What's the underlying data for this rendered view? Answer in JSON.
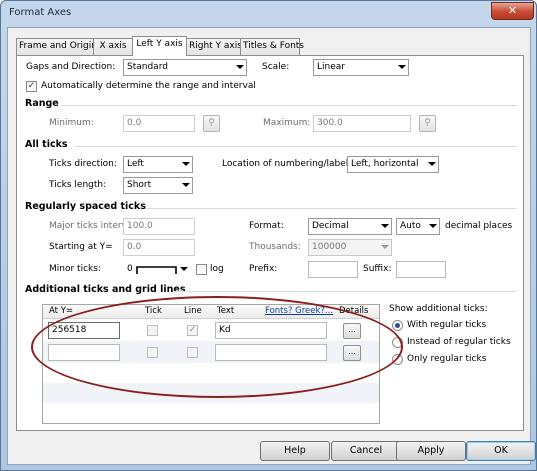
{
  "window": {
    "title": "Format Axes",
    "close_glyph": "✕"
  },
  "tabs": [
    {
      "label": "Frame and Origin"
    },
    {
      "label": "X axis"
    },
    {
      "label": "Left Y axis"
    },
    {
      "label": "Right Y axis"
    },
    {
      "label": "Titles & Fonts"
    }
  ],
  "top": {
    "gaps_label": "Gaps and Direction:",
    "gaps_value": "Standard",
    "scale_label": "Scale:",
    "scale_value": "Linear",
    "auto_label": "Automatically determine the range and interval",
    "auto_checked": "✓"
  },
  "range": {
    "heading": "Range",
    "min_label": "Minimum:",
    "min_value": "0.0",
    "max_label": "Maximum:",
    "max_value": "300.0",
    "lock_icon_glyph": "⚲"
  },
  "all_ticks": {
    "heading": "All ticks",
    "direction_label": "Ticks direction:",
    "direction_value": "Left",
    "location_label": "Location of numbering/labeling:",
    "location_value": "Left, horizontal",
    "length_label": "Ticks length:",
    "length_value": "Short"
  },
  "regular": {
    "heading": "Regularly spaced ticks",
    "major_label": "Major ticks interval:",
    "major_value": "100.0",
    "start_label": "Starting at Y=",
    "start_value": "0.0",
    "minor_label": "Minor ticks:",
    "minor_value": "0",
    "log_label": "log",
    "format_label": "Format:",
    "format_value": "Decimal",
    "decimals_value": "Auto",
    "decimals_label": "decimal places",
    "thousands_label": "Thousands:",
    "thousands_value": "100000",
    "prefix_label": "Prefix:",
    "prefix_value": "",
    "suffix_label": "Suffix:",
    "suffix_value": ""
  },
  "additional": {
    "heading": "Additional ticks and grid lines",
    "columns": {
      "at": "At Y=",
      "tick": "Tick",
      "line": "Line",
      "text": "Text",
      "fonts_link": "Fonts? Greek?...",
      "details": "Details"
    },
    "rows": [
      {
        "at": "256518",
        "tick": "",
        "line": "✓",
        "text": "Kd",
        "details": "..."
      },
      {
        "at": "",
        "tick": "",
        "line": "",
        "text": "",
        "details": "..."
      }
    ],
    "show_label": "Show additional ticks:",
    "options": [
      {
        "label": "With regular ticks",
        "selected": true
      },
      {
        "label": "Instead of regular ticks",
        "selected": false
      },
      {
        "label": "Only regular ticks",
        "selected": false
      }
    ]
  },
  "buttons": {
    "help": "Help",
    "cancel": "Cancel",
    "apply": "Apply",
    "ok": "OK"
  }
}
